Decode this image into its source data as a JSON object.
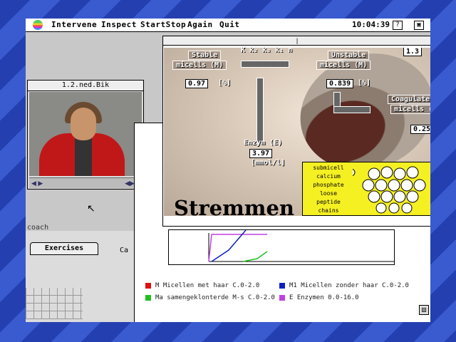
{
  "menubar": {
    "items": [
      "Intervene",
      "Inspect",
      "StartStop",
      "Again",
      "Quit"
    ],
    "clock": "10:04:39",
    "help_icon": "?",
    "app_icon": "▣"
  },
  "video_window": {
    "title": "1.2.ned.Bik",
    "controls_left": "◀ ▶",
    "controls_right": "◀▶ ▸"
  },
  "coach": {
    "label": "coach",
    "tab_exercises": "Exercises",
    "tab_other": "Ca"
  },
  "main_window": {
    "title_mark": "|",
    "stable_label": "Stable",
    "stable_sub": "micells (M)",
    "stable_value": "0.97",
    "stable_unit": "[%]",
    "rates": "K  k₂  k₃  k₁ n",
    "unstable_label": "Unstable",
    "unstable_sub": "micells (M)",
    "unstable_value": "0.839",
    "unstable_unit": "[%]",
    "coag_label": "Coagulate",
    "coag_sub": "micells (",
    "coag_value": "0.25",
    "top_right_value": "1.3",
    "enzym_label": "Enzym (E)",
    "enzym_value": "3.97",
    "enzym_unit": "[mmol/l]",
    "title_text": "Stremmen",
    "legend_lines": [
      "submicell",
      "calcium",
      "phosphate",
      "loose",
      "peptide",
      "chains"
    ]
  },
  "series_legend": [
    {
      "label": "M Micellen met haar C.0-2.0",
      "color": "#e01010"
    },
    {
      "label": "M1 Micellen zonder haar C.0-2.0",
      "color": "#1020c0"
    },
    {
      "label": "Ma samengeklonterde M-s C.0-2.0",
      "color": "#20c020"
    },
    {
      "label": "E Enzymen 0.0-16.0",
      "color": "#c040e0"
    }
  ]
}
